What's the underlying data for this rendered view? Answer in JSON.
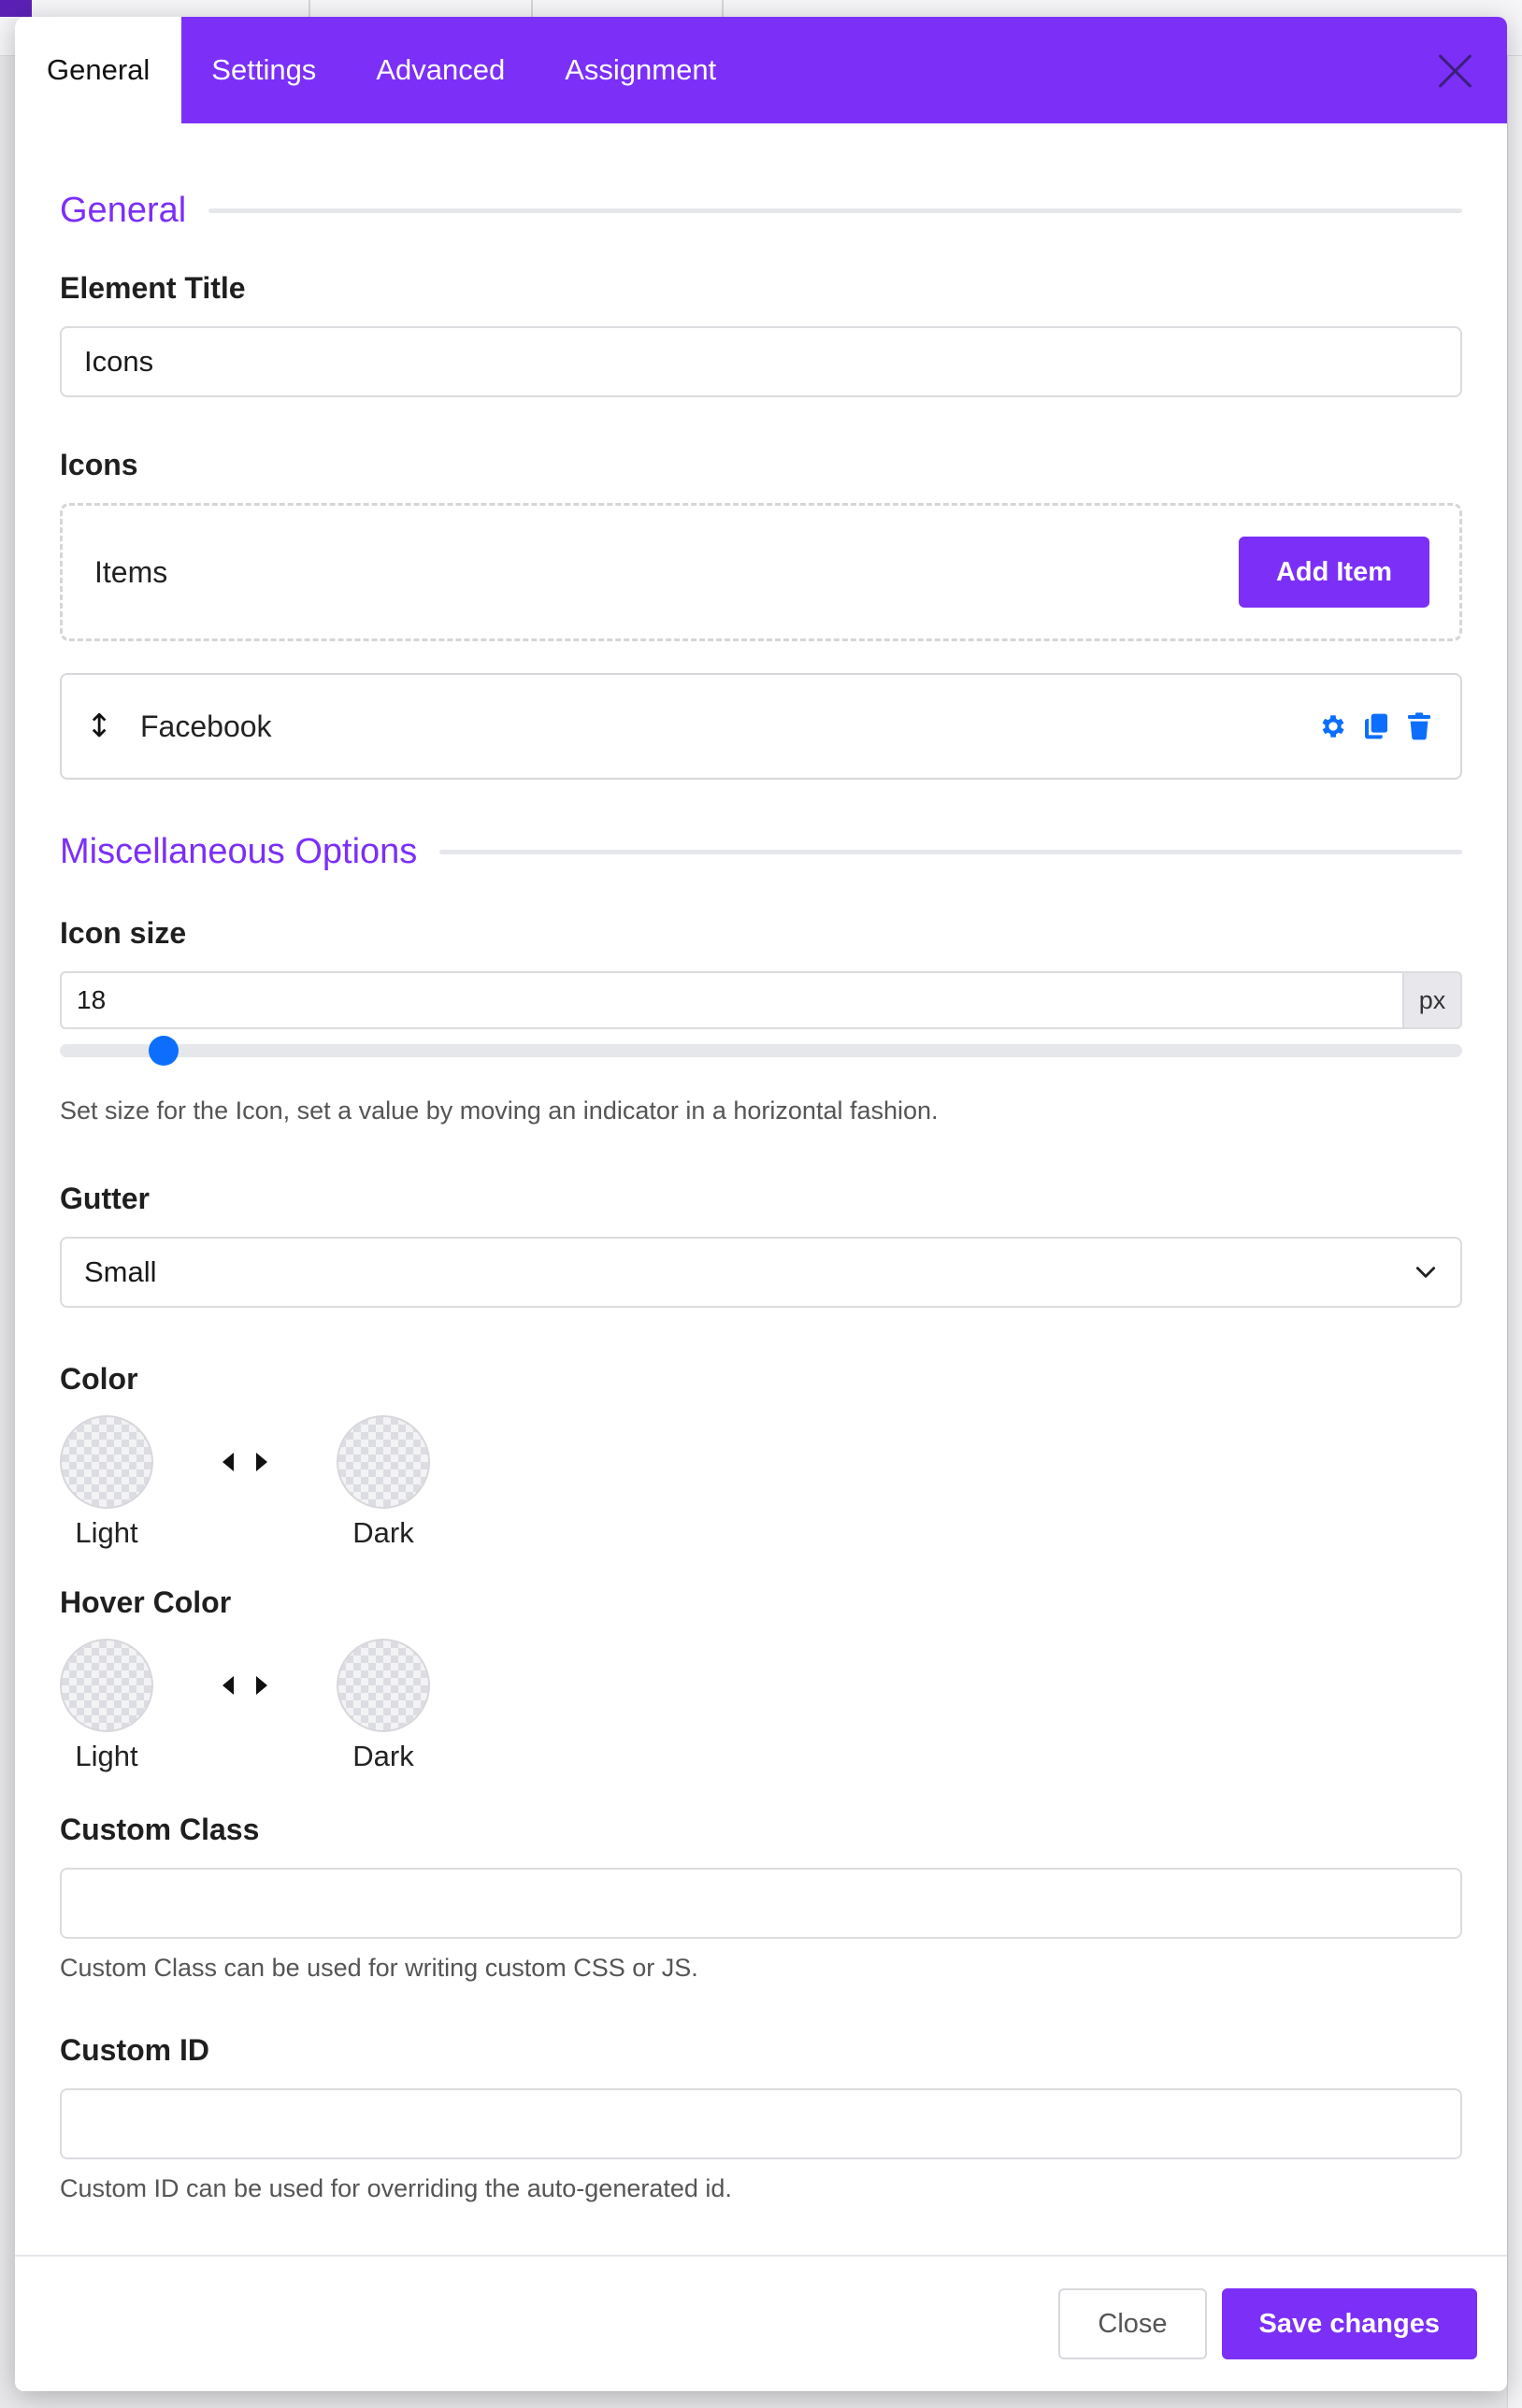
{
  "modal": {
    "tabs": [
      {
        "label": "General"
      },
      {
        "label": "Settings"
      },
      {
        "label": "Advanced"
      },
      {
        "label": "Assignment"
      }
    ]
  },
  "general": {
    "section_title": "General",
    "element_title_label": "Element Title",
    "element_title_value": "Icons",
    "icons_label": "Icons",
    "items_label": "Items",
    "add_item_label": "Add Item",
    "items": [
      {
        "label": "Facebook"
      }
    ]
  },
  "misc": {
    "section_title": "Miscellaneous Options",
    "icon_size_label": "Icon size",
    "icon_size_value": "18",
    "icon_size_unit": "px",
    "icon_size_slider_fraction": 0.065,
    "icon_size_help": "Set size for the Icon, set a value by moving an indicator in a horizontal fashion.",
    "gutter_label": "Gutter",
    "gutter_value": "Small",
    "color_label": "Color",
    "hover_color_label": "Hover Color",
    "light_label": "Light",
    "dark_label": "Dark",
    "custom_class_label": "Custom Class",
    "custom_class_value": "",
    "custom_class_help": "Custom Class can be used for writing custom CSS or JS.",
    "custom_id_label": "Custom ID",
    "custom_id_value": "",
    "custom_id_help": "Custom ID can be used for overriding the auto-generated id."
  },
  "footer": {
    "close_label": "Close",
    "save_label": "Save changes"
  },
  "colors": {
    "accent": "#7b2ff7",
    "action_blue": "#0d6efd"
  }
}
